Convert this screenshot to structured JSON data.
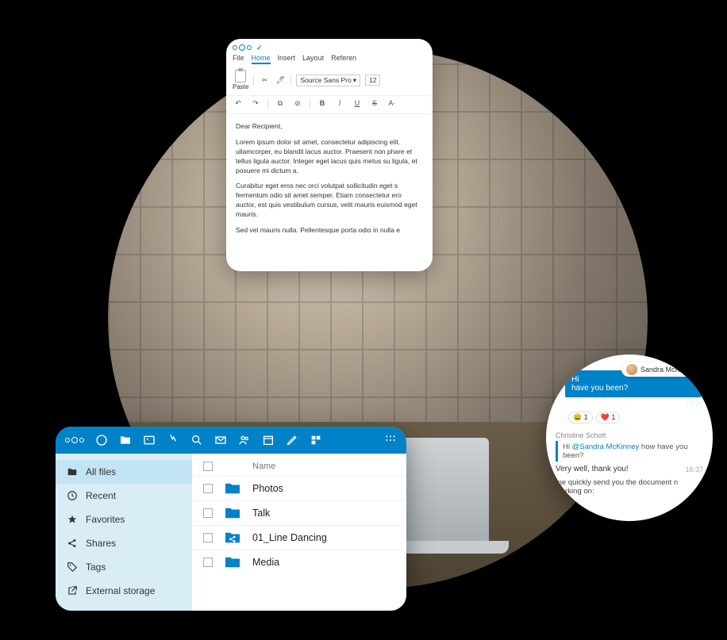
{
  "doc": {
    "menu": {
      "file": "File",
      "home": "Home",
      "insert": "Insert",
      "layout": "Layout",
      "references": "Referen"
    },
    "font": "Source Sans Pro",
    "fontsize": "12",
    "paste_label": "Paste",
    "greeting": "Dear Recipient,",
    "para1": "Lorem ipsum dolor sit amet, consectetur adipiscing elit. ullamcorper, eu blandit lacus auctor. Praesent non phare et tellus ligula auctor. Integer eget lacus quis metus su ligula, et posuere mi dictum a.",
    "para2": "Curabitur eget eros nec orci volutpat sollicitudin eget s fermentum odio sit amet semper. Etiam consectetur ero auctor, est quis vestibulum cursus, velit mauris euismod eget mauris.",
    "para3": "Sed vel mauris nulla. Pellentesque porta odio in nulla e"
  },
  "files": {
    "sidebar": {
      "all_files": "All files",
      "recent": "Recent",
      "favorites": "Favorites",
      "shares": "Shares",
      "tags": "Tags",
      "external": "External storage"
    },
    "list": {
      "header_name": "Name",
      "rows": [
        {
          "name": "Photos",
          "shared": false
        },
        {
          "name": "Talk",
          "shared": false
        },
        {
          "name": "01_Line Dancing",
          "shared": true
        },
        {
          "name": "Media",
          "shared": false
        }
      ]
    }
  },
  "chat": {
    "sender_name": "Sandra McKinney",
    "msg_hi": "Hi",
    "msg_line": "have you been?",
    "time1": "16:36",
    "react1": "😀 1",
    "react2": "❤️ 1",
    "reply_author": "Christine Schott",
    "reply_quote_prefix": "Hi ",
    "reply_quote_mention": "@Sandra McKinney",
    "reply_quote_suffix": "  how have you been?",
    "reply_text": "Very well, thank you!",
    "time2": "16:37",
    "followup": "me quickly send you the document n working on:"
  }
}
